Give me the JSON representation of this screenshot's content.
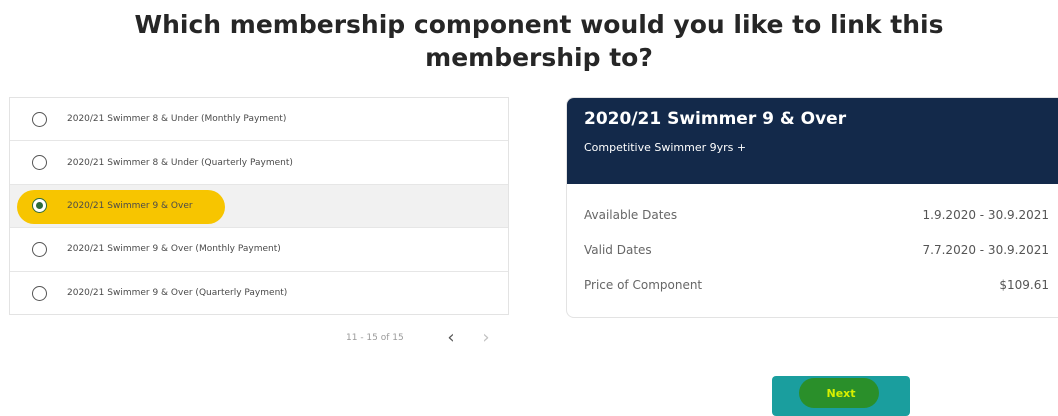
{
  "page": {
    "title_line1": "Which membership component would you like to link this",
    "title_line2": "membership to?"
  },
  "options": [
    {
      "label": "2020/21 Swimmer 8 & Under (Monthly Payment)",
      "selected": false
    },
    {
      "label": "2020/21 Swimmer 8 & Under (Quarterly Payment)",
      "selected": false
    },
    {
      "label": "2020/21 Swimmer 9 & Over",
      "selected": true
    },
    {
      "label": "2020/21 Swimmer 9 & Over (Monthly Payment)",
      "selected": false
    },
    {
      "label": "2020/21 Swimmer 9 & Over (Quarterly Payment)",
      "selected": false
    }
  ],
  "pagination": {
    "range": "11 - 15 of 15",
    "prev_icon": "chevron-left",
    "next_icon": "chevron-right"
  },
  "detail": {
    "title": "2020/21 Swimmer 9 & Over",
    "subtitle": "Competitive Swimmer 9yrs +",
    "rows": [
      {
        "label": "Available Dates",
        "value": "1.9.2020 - 30.9.2021"
      },
      {
        "label": "Valid Dates",
        "value": "7.7.2020 - 30.9.2021"
      },
      {
        "label": "Price of Component",
        "value": "$109.61"
      }
    ]
  },
  "actions": {
    "next_label": "Next"
  },
  "colors": {
    "header_bg": "#13294a",
    "accent_teal": "#1a9e9e",
    "highlight_yellow": "#f7c500",
    "selected_green": "#2d6b3a"
  }
}
